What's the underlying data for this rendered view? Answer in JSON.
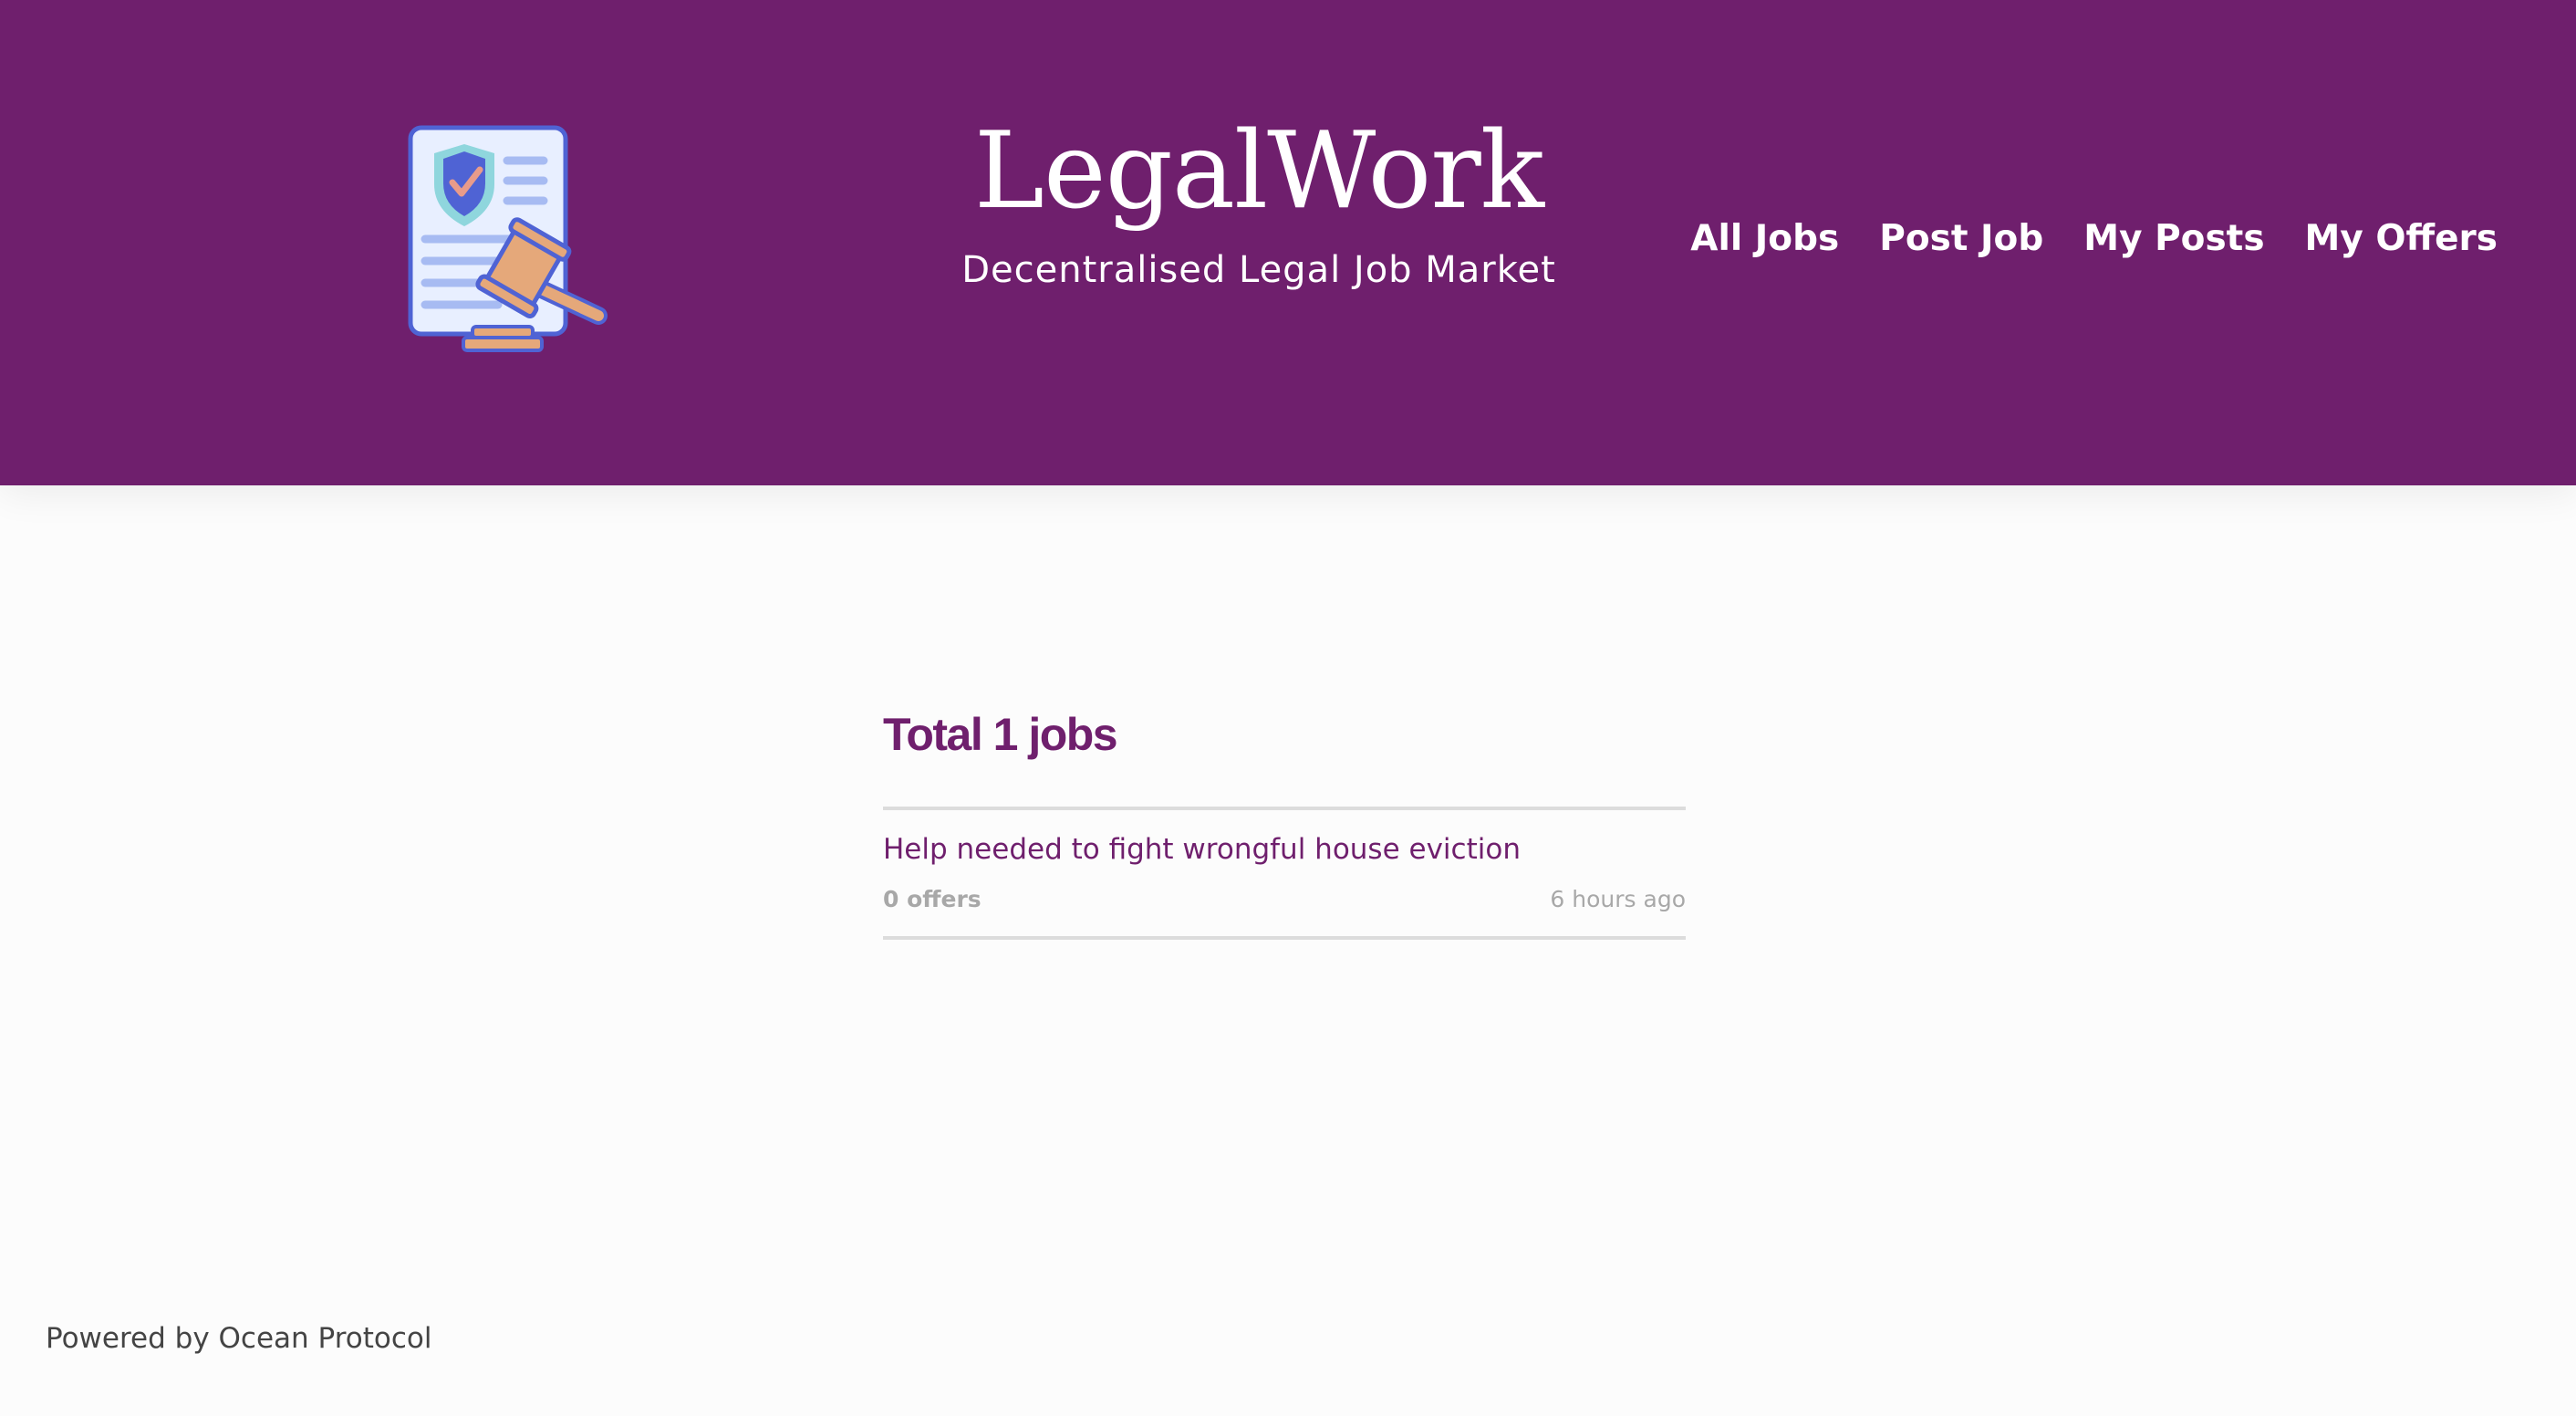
{
  "header": {
    "title": "LegalWork",
    "subtitle": "Decentralised Legal Job Market",
    "logo_icon": "legal-document-gavel-icon",
    "background_color": "#6f1f6d"
  },
  "nav": {
    "items": [
      {
        "label": "All Jobs"
      },
      {
        "label": "Post Job"
      },
      {
        "label": "My Posts"
      },
      {
        "label": "My Offers"
      }
    ]
  },
  "main": {
    "total_label": "Total 1 jobs",
    "jobs": [
      {
        "title": "Help needed to fight wrongful house eviction",
        "offers": "0 offers",
        "time": "6 hours ago"
      }
    ]
  },
  "footer": {
    "text": "Powered by Ocean Protocol"
  },
  "colors": {
    "accent": "#6f1f6d",
    "divider": "#dcdcdc",
    "muted_text": "#a8a8a8"
  }
}
